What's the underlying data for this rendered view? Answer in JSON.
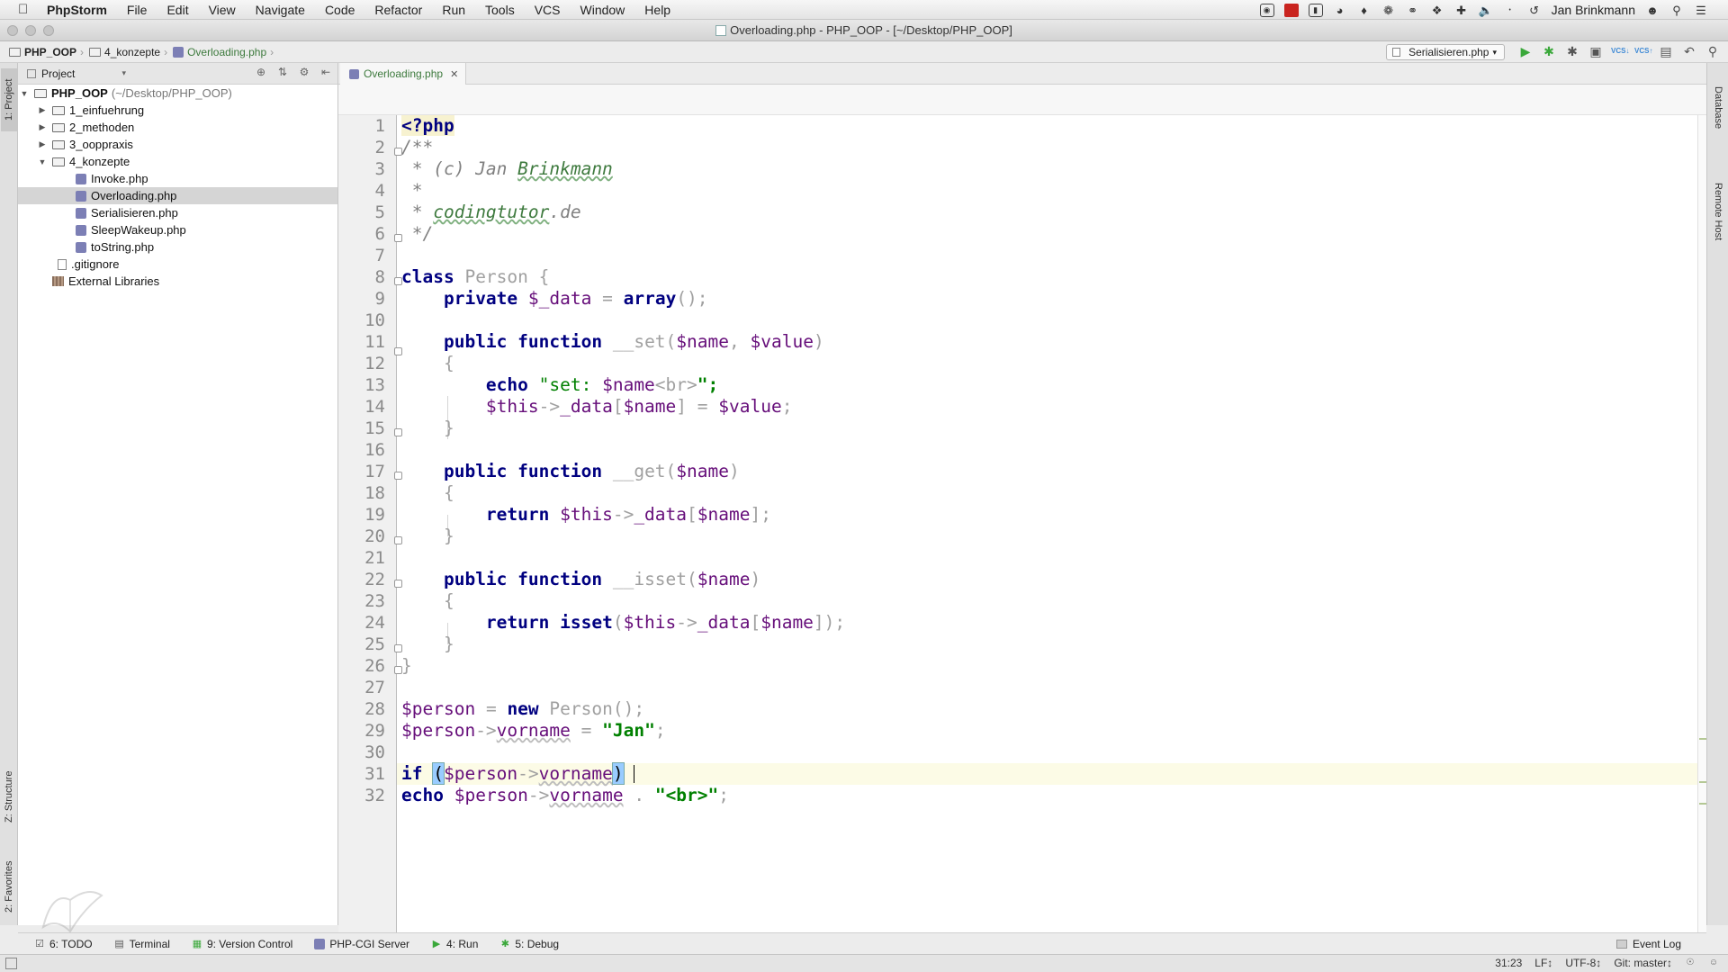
{
  "menubar": {
    "app_name": "PhpStorm",
    "items": [
      "File",
      "Edit",
      "View",
      "Navigate",
      "Code",
      "Refactor",
      "Run",
      "Tools",
      "VCS",
      "Window",
      "Help"
    ],
    "user": "Jan Brinkmann"
  },
  "window": {
    "title": "Overloading.php - PHP_OOP - [~/Desktop/PHP_OOP]"
  },
  "breadcrumbs": [
    "PHP_OOP",
    "4_konzepte",
    "Overloading.php"
  ],
  "run_config": {
    "label": "Serialisieren.php"
  },
  "project_panel": {
    "header": "Project",
    "root_name": "PHP_OOP",
    "root_path": "(~/Desktop/PHP_OOP)",
    "folders": [
      "1_einfuehrung",
      "2_methoden",
      "3_ooppraxis",
      "4_konzepte"
    ],
    "files": [
      "Invoke.php",
      "Overloading.php",
      "Serialisieren.php",
      "SleepWakeup.php",
      "toString.php"
    ],
    "gitignore": ".gitignore",
    "external": "External Libraries"
  },
  "editor": {
    "active_tab": "Overloading.php",
    "line_numbers": [
      "1",
      "2",
      "3",
      "4",
      "5",
      "6",
      "7",
      "8",
      "9",
      "10",
      "11",
      "12",
      "13",
      "14",
      "15",
      "16",
      "17",
      "18",
      "19",
      "20",
      "21",
      "22",
      "23",
      "24",
      "25",
      "26",
      "27",
      "28",
      "29",
      "30",
      "31",
      "32"
    ],
    "code": {
      "l1": "<?php",
      "l2": "/**",
      "l3_pre": " * (c) Jan ",
      "l3_u": "Brinkmann",
      "l4": " *",
      "l5_pre": " * ",
      "l5_u": "codingtutor",
      "l5_post": ".de",
      "l6": " */",
      "kw_class": "class",
      "class_name": "Person",
      "brace_open": "{",
      "brace_close": "}",
      "kw_private": "private",
      "var_data": "$_data",
      "op_assign": "=",
      "kw_array": "array",
      "paren_pair": "();",
      "kw_public": "public",
      "kw_function": "function",
      "m_set": "__set",
      "m_get": "__get",
      "m_isset": "__isset",
      "var_name": "$name",
      "var_value": "$value",
      "kw_echo": "echo",
      "str_set_open": "\"set: ",
      "str_br_tag": "<br>",
      "str_close": "\";",
      "var_this": "$this",
      "arrow": "->",
      "prop_data": "_data",
      "kw_return": "return",
      "kw_isset": "isset",
      "var_person": "$person",
      "kw_new": "new",
      "prop_vorname": "vorname",
      "str_jan": "\"Jan\"",
      "kw_if": "if",
      "str_br": "\"<br>\"",
      "semicolon": ";",
      "comma": ",",
      "dot": "."
    }
  },
  "right_tabs": {
    "database": "Database",
    "remote_host": "Remote Host"
  },
  "left_tabs": {
    "project": "1: Project",
    "structure": "Z: Structure",
    "favorites": "2: Favorites"
  },
  "bottom_tools": {
    "todo": "6: TODO",
    "terminal": "Terminal",
    "version_control": "9: Version Control",
    "php_cgi": "PHP-CGI Server",
    "run": "4: Run",
    "debug": "5: Debug",
    "event_log": "Event Log"
  },
  "status": {
    "position": "31:23",
    "line_sep": "LF↕",
    "encoding": "UTF-8↕",
    "git": "Git: master↕"
  }
}
